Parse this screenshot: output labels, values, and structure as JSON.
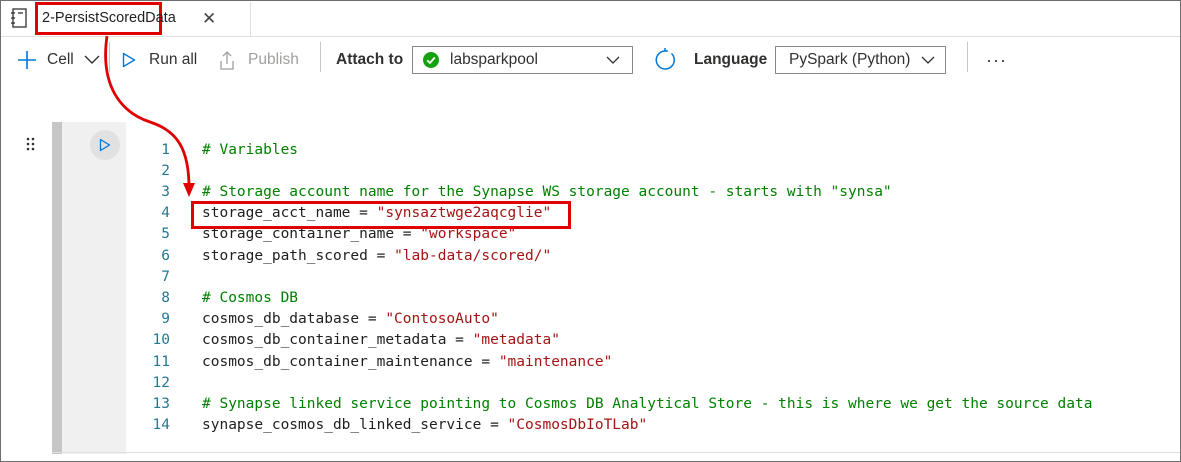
{
  "tab": {
    "title": "2-PersistScoredData",
    "close_glyph": "✕"
  },
  "toolbar": {
    "cell_label": "Cell",
    "run_all_label": "Run all",
    "publish_label": "Publish",
    "attach_to_label": "Attach to",
    "attach_to_value": "labsparkpool",
    "language_label": "Language",
    "language_value": "PySpark (Python)",
    "more_glyph": "···"
  },
  "editor": {
    "lines": [
      {
        "n": "1",
        "parts": [
          {
            "t": "comment",
            "v": "# Variables"
          }
        ]
      },
      {
        "n": "2",
        "parts": []
      },
      {
        "n": "3",
        "parts": [
          {
            "t": "comment",
            "v": "# Storage account name for the Synapse WS storage account - starts with \"synsa\""
          }
        ]
      },
      {
        "n": "4",
        "parts": [
          {
            "t": "text",
            "v": "storage_acct_name = "
          },
          {
            "t": "string",
            "v": "\"synsaztwge2aqcglie\""
          }
        ]
      },
      {
        "n": "5",
        "parts": [
          {
            "t": "text",
            "v": "storage_container_name = "
          },
          {
            "t": "string",
            "v": "\"workspace\""
          }
        ]
      },
      {
        "n": "6",
        "parts": [
          {
            "t": "text",
            "v": "storage_path_scored = "
          },
          {
            "t": "string",
            "v": "\"lab-data/scored/\""
          }
        ]
      },
      {
        "n": "7",
        "parts": []
      },
      {
        "n": "8",
        "parts": [
          {
            "t": "comment",
            "v": "# Cosmos DB"
          }
        ]
      },
      {
        "n": "9",
        "parts": [
          {
            "t": "text",
            "v": "cosmos_db_database = "
          },
          {
            "t": "string",
            "v": "\"ContosoAuto\""
          }
        ]
      },
      {
        "n": "10",
        "parts": [
          {
            "t": "text",
            "v": "cosmos_db_container_metadata = "
          },
          {
            "t": "string",
            "v": "\"metadata\""
          }
        ]
      },
      {
        "n": "11",
        "parts": [
          {
            "t": "text",
            "v": "cosmos_db_container_maintenance = "
          },
          {
            "t": "string",
            "v": "\"maintenance\""
          }
        ]
      },
      {
        "n": "12",
        "parts": []
      },
      {
        "n": "13",
        "parts": [
          {
            "t": "comment",
            "v": "# Synapse linked service pointing to Cosmos DB Analytical Store - this is where we get the source data"
          }
        ]
      },
      {
        "n": "14",
        "parts": [
          {
            "t": "text",
            "v": "synapse_cosmos_db_linked_service = "
          },
          {
            "t": "string",
            "v": "\"CosmosDbIoTLab\""
          }
        ]
      }
    ]
  },
  "colors": {
    "accent": "#0078d4",
    "highlight_red": "#e00000",
    "code_comment": "#008000",
    "code_string": "#a31515",
    "line_number": "#237893",
    "status_ok": "#13a10e"
  },
  "icons": [
    "notebook-icon",
    "close-icon",
    "plus-icon",
    "chevron-down-icon",
    "play-icon",
    "publish-icon",
    "check-circle-icon",
    "refresh-icon",
    "more-icon",
    "drag-handle-icon",
    "run-cell-icon"
  ]
}
